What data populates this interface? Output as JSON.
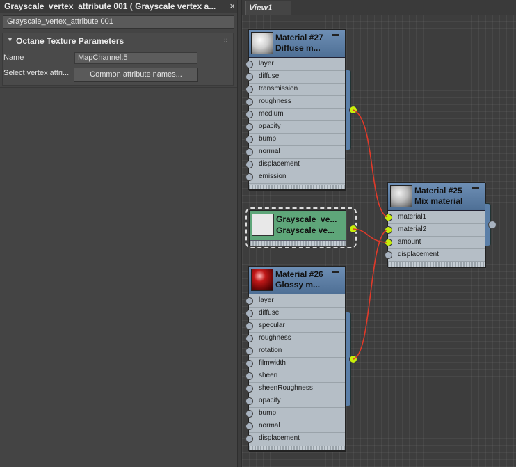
{
  "left_panel": {
    "title": "Grayscale_vertex_attribute 001  ( Grayscale vertex a...",
    "close_glyph": "×",
    "name_field_value": "Grayscale_vertex_attribute 001",
    "rollout": {
      "title": "Octane Texture Parameters",
      "name_label": "Name",
      "name_value": "MapChannel:5",
      "select_label": "Select vertex attri...",
      "button_label": "Common attribute names..."
    }
  },
  "view": {
    "tab_label": "View1",
    "nodes": {
      "mat27": {
        "title1": "Material #27",
        "title2": "Diffuse m...",
        "slots": [
          "layer",
          "diffuse",
          "transmission",
          "roughness",
          "medium",
          "opacity",
          "bump",
          "normal",
          "displacement",
          "emission"
        ]
      },
      "gray": {
        "title1": "Grayscale_ve...",
        "title2": "Grayscale ve..."
      },
      "mat25": {
        "title1": "Material #25",
        "title2": "Mix material",
        "slots": [
          "material1",
          "material2",
          "amount",
          "displacement"
        ]
      },
      "mat26": {
        "title1": "Material #26",
        "title2": "Glossy m...",
        "slots": [
          "layer",
          "diffuse",
          "specular",
          "roughness",
          "rotation",
          "filmwidth",
          "sheen",
          "sheenRoughness",
          "opacity",
          "bump",
          "normal",
          "displacement"
        ]
      }
    },
    "colors": {
      "wire": "#e03a2a",
      "connector_active": "#c8ee0a",
      "node_header": "#5a7aa0",
      "texture_node": "#5ea679"
    }
  }
}
